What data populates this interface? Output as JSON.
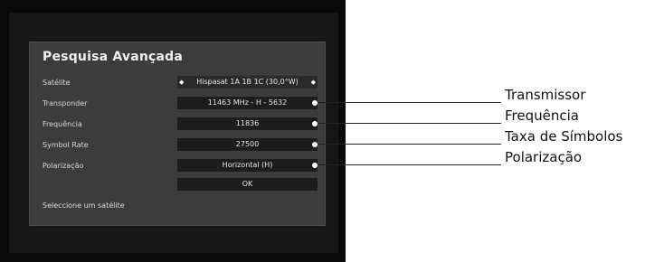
{
  "dialog": {
    "title": "Pesquisa Avançada",
    "rows": [
      {
        "label": "Satélite",
        "value": "Hispasat 1A 1B 1C (30,0°W)"
      },
      {
        "label": "Transponder",
        "value": "11463 MHz - H - 5632"
      },
      {
        "label": "Frequência",
        "value": "11836"
      },
      {
        "label": "Symbol Rate",
        "value": "27500"
      },
      {
        "label": "Polarização",
        "value": "Horizontal (H)"
      }
    ],
    "ok_label": "OK",
    "hint": "Seleccione um satélite"
  },
  "callouts": [
    "Transmissor",
    "Frequência",
    "Taxa de Símbolos",
    "Polarização"
  ],
  "icons": {
    "left": "left-arrow-icon",
    "right": "right-arrow-icon"
  }
}
